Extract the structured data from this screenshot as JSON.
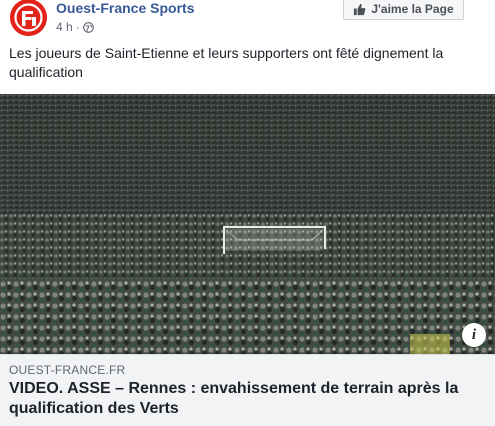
{
  "header": {
    "page_name": "Ouest-France Sports",
    "time": "4 h",
    "separator": "·",
    "like_button_label": "J'aime la Page",
    "logo_color": "#e2231a"
  },
  "post": {
    "text": "Les joueurs de Saint-Etienne et leurs supporters ont fêté dignement la qualification"
  },
  "photo": {
    "info_icon": "i"
  },
  "link_preview": {
    "domain": "OUEST-FRANCE.FR",
    "title": "VIDEO. ASSE – Rennes : envahissement de terrain après la qualification des Verts"
  },
  "colors": {
    "link_blue": "#385898",
    "text_dark": "#1d2129",
    "meta_gray": "#606770",
    "preview_bg": "#f2f3f5"
  }
}
